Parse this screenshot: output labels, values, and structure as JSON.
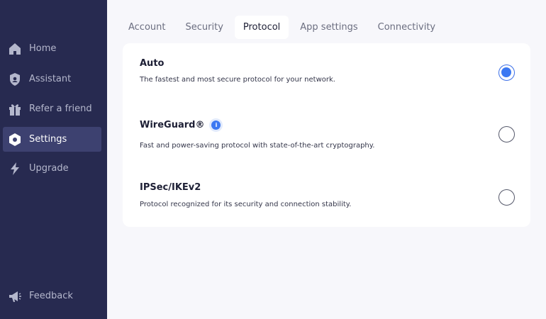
{
  "sidebar": {
    "items": [
      {
        "label": "Home",
        "icon": "home-icon"
      },
      {
        "label": "Assistant",
        "icon": "shield-icon"
      },
      {
        "label": "Refer a friend",
        "icon": "gift-icon"
      },
      {
        "label": "Settings",
        "icon": "settings-icon",
        "active": true
      },
      {
        "label": "Upgrade",
        "icon": "lightning-icon"
      }
    ],
    "feedback_label": "Feedback"
  },
  "tabs": [
    {
      "label": "Account"
    },
    {
      "label": "Security"
    },
    {
      "label": "Protocol",
      "active": true
    },
    {
      "label": "App settings"
    },
    {
      "label": "Connectivity"
    }
  ],
  "protocols": [
    {
      "title": "Auto",
      "description": "The fastest and most secure protocol for your network.",
      "selected": true
    },
    {
      "title": "WireGuard®",
      "description": "Fast and power-saving protocol with state-of-the-art cryptography.",
      "selected": false,
      "info": "i"
    },
    {
      "title": "IPSec/IKEv2",
      "description": "Protocol recognized for its security and connection stability.",
      "selected": false
    }
  ],
  "colors": {
    "sidebar_bg": "#272a50",
    "accent": "#3c78f2"
  }
}
